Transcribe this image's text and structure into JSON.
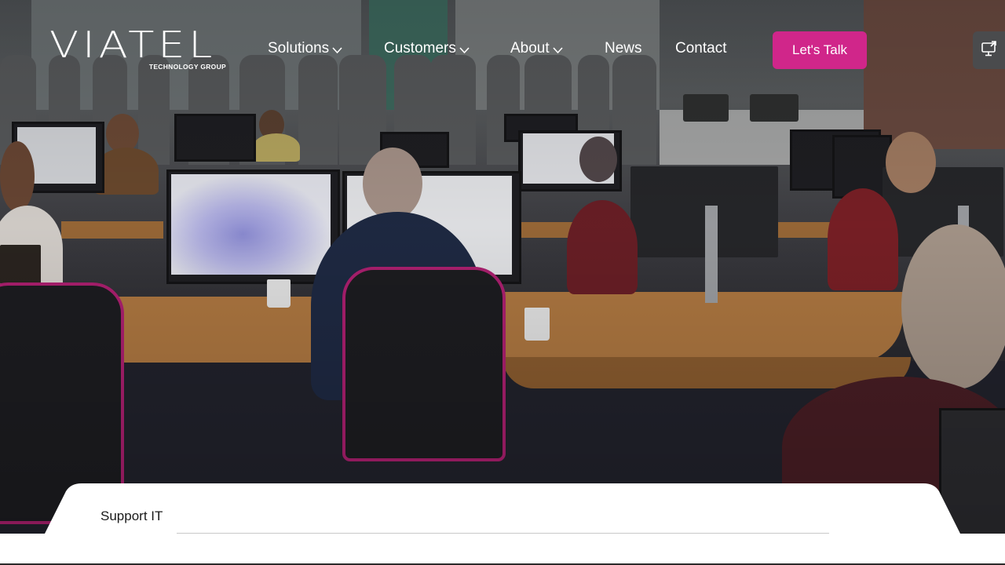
{
  "brand": {
    "name": "VIATEL",
    "tagline": "TECHNOLOGY GROUP",
    "accent_color": "#d0268a"
  },
  "nav": {
    "items": [
      {
        "label": "Solutions",
        "has_dropdown": true
      },
      {
        "label": "Customers",
        "has_dropdown": true
      },
      {
        "label": "About",
        "has_dropdown": true
      },
      {
        "label": "News",
        "has_dropdown": false
      },
      {
        "label": "Contact",
        "has_dropdown": false
      }
    ],
    "cta_label": "Let's Talk",
    "side_button_icon": "monitor-share-icon"
  },
  "hero": {
    "image_description": "Open-plan office with staff working at desks and monitors"
  },
  "tabs": {
    "items": [
      {
        "label": "Support IT",
        "active": true
      }
    ]
  }
}
